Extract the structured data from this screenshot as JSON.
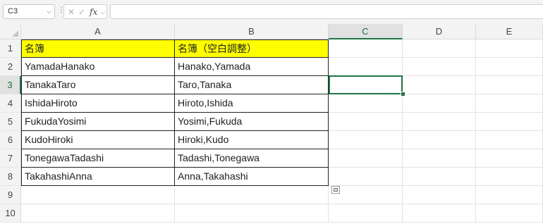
{
  "formula_bar": {
    "name_box": "C3",
    "name_box_arrow": "⌵",
    "separator": "⋮",
    "cancel_icon": "✕",
    "enter_icon": "✓",
    "fx_label": "fx",
    "fx_caret": "⌵",
    "formula": ""
  },
  "columns": [
    "A",
    "B",
    "C",
    "D",
    "E"
  ],
  "rows": [
    "1",
    "2",
    "3",
    "4",
    "5",
    "6",
    "7",
    "8",
    "9",
    "10"
  ],
  "table": {
    "header": [
      "名簿",
      "名簿（空白調整）"
    ],
    "data": [
      [
        "YamadaHanako",
        "Hanako,Yamada"
      ],
      [
        "TanakaTaro",
        "Taro,Tanaka"
      ],
      [
        "IshidaHiroto",
        "Hiroto,Ishida"
      ],
      [
        "FukudaYosimi",
        "Yosimi,Fukuda"
      ],
      [
        "KudoHiroki",
        "Hiroki,Kudo"
      ],
      [
        "TonegawaTadashi",
        "Tadashi,Tonegawa"
      ],
      [
        "TakahashiAnna",
        "Anna,Takahashi"
      ]
    ]
  },
  "selection": {
    "cell": "C3"
  },
  "colors": {
    "header_fill": "#ffff00",
    "selection": "#217346"
  }
}
